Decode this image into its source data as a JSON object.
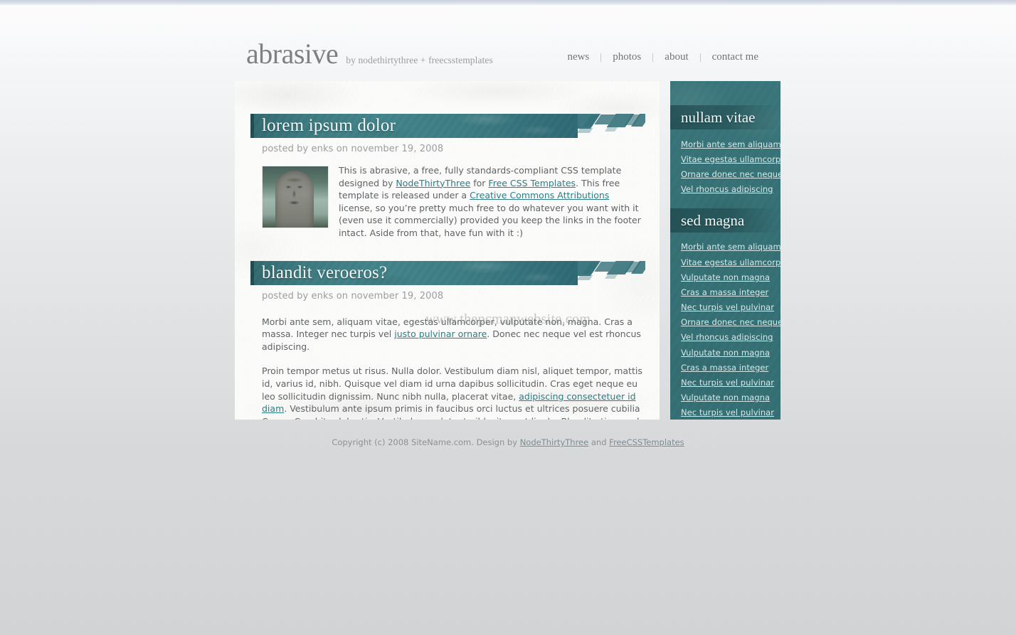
{
  "site": {
    "logo": "abrasive",
    "tagline": "by nodethirtythree + freecsstemplates"
  },
  "nav": {
    "items": [
      {
        "label": "news"
      },
      {
        "label": "photos"
      },
      {
        "label": "about"
      },
      {
        "label": "contact me"
      }
    ]
  },
  "posts": [
    {
      "title": "lorem ipsum dolor",
      "meta": "posted by enks on november 19, 2008",
      "has_thumb": true,
      "thumb_alt": "stone statue photograph",
      "body_parts": [
        {
          "type": "text",
          "value": "This is abrasive, a free, fully standards-compliant CSS template designed by "
        },
        {
          "type": "link",
          "value": "NodeThirtyThree"
        },
        {
          "type": "text",
          "value": " for "
        },
        {
          "type": "link",
          "value": "Free CSS Templates"
        },
        {
          "type": "text",
          "value": ". This free template is released under a "
        },
        {
          "type": "link",
          "value": "Creative Commons Attributions"
        },
        {
          "type": "text",
          "value": " license, so you’re pretty much free to do whatever you want with it (even use it commercially) provided you keep the links in the footer intact. Aside from that, have fun with it :)"
        }
      ]
    },
    {
      "title": "blandit veroeros?",
      "meta": "posted by enks on november 19, 2008",
      "has_thumb": false,
      "paragraph_1": [
        {
          "type": "text",
          "value": "Morbi ante sem, aliquam vitae, egestas ullamcorper, vulputate non, magna. Cras a massa. Integer nec turpis vel "
        },
        {
          "type": "link",
          "value": "justo pulvinar ornare"
        },
        {
          "type": "text",
          "value": ". Donec nec neque vel est rhoncus adipiscing."
        }
      ],
      "paragraph_2": [
        {
          "type": "text",
          "value": "Proin tempor metus ut risus. Nulla dolor. Vestibulum diam nisl, aliquet tempor, mattis id, varius id, nibh. Quisque vel diam id urna dapibus sollicitudin. Cras eget neque eu leo sollicitudin dignissim. Nunc nibh nulla, placerat vitae, "
        },
        {
          "type": "link",
          "value": "adipiscing consectetuer id diam"
        },
        {
          "type": "text",
          "value": ". Vestibulum ante ipsum primis in faucibus orci luctus et ultrices posuere cubilia Curae; Curabitur lobortis. Vestibulum volutpat nibh sit amet ligula. Blandit etiam sed lorem lobortis. Integer turpis."
        }
      ]
    }
  ],
  "watermark": "www.thepcmanwebsite.com",
  "sidebar": {
    "blocks": [
      {
        "title": "nullam vitae",
        "links": [
          "Morbi ante sem aliquam",
          "Vitae egestas ullamcorpe",
          "Ornare donec nec neque",
          "Vel rhoncus adipiscing"
        ]
      },
      {
        "title": "sed magna",
        "links": [
          "Morbi ante sem aliquam",
          "Vitae egestas ullamcorpe",
          "Vulputate non magna",
          "Cras a massa integer",
          "Nec turpis vel pulvinar",
          "Ornare donec nec neque",
          "Vel rhoncus adipiscing",
          "Vulputate non magna",
          "Cras a massa integer",
          "Nec turpis vel pulvinar",
          "Vulputate non magna",
          "Nec turpis vel pulvinar"
        ]
      }
    ]
  },
  "footer": {
    "prefix": "Copyright (c) 2008 SiteName.com. Design by ",
    "link1": "NodeThirtyThree",
    "middle": " and ",
    "link2": "FreeCSSTemplates"
  },
  "colors": {
    "teal_dark": "#2d5e64",
    "teal": "#357075",
    "teal_light": "#43858b",
    "link": "#2d7d85",
    "body_text": "#5f6365",
    "muted": "#9a9e9f",
    "page_bg": "#d2d4d5"
  }
}
